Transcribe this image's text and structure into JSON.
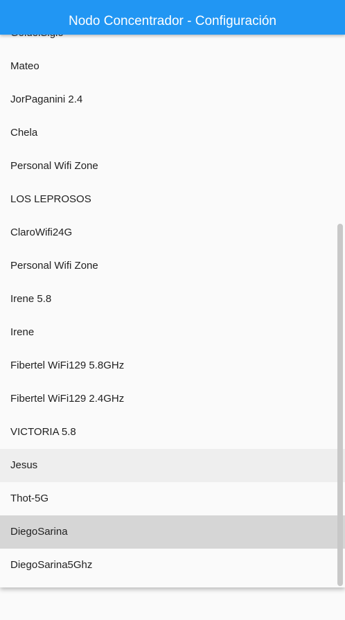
{
  "app_bar": {
    "title": "Nodo Concentrador - Configuración",
    "color": "#2196f3"
  },
  "networks": [
    "GoldelSiglo",
    "Mateo",
    "JorPaganini 2.4",
    "Chela",
    "Personal Wifi Zone",
    "LOS LEPROSOS",
    "ClaroWifi24G",
    "Personal Wifi Zone",
    "Irene 5.8",
    "Irene",
    "Fibertel WiFi129 5.8GHz",
    "Fibertel WiFi129 2.4GHz",
    "VICTORIA 5.8",
    "Jesus",
    "Thot-5G",
    "DiegoSarina",
    "DiegoSarina5Ghz"
  ]
}
